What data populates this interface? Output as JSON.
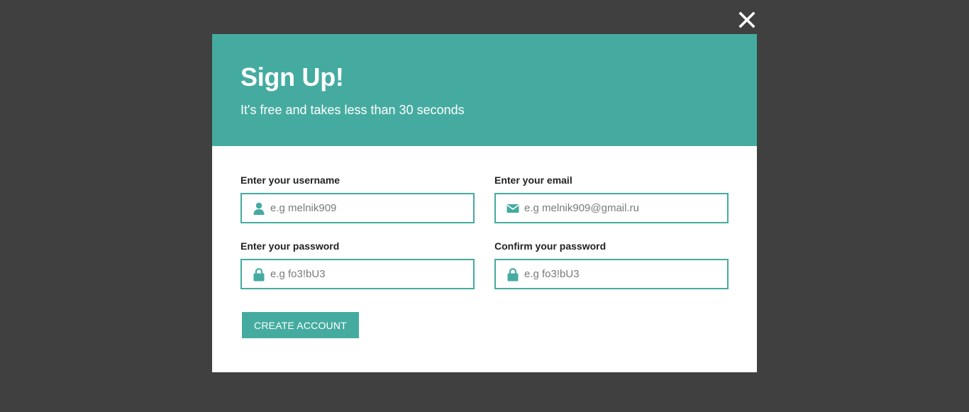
{
  "modal": {
    "title": "Sign Up!",
    "subtitle": "It's free and takes less than 30 seconds",
    "close_icon": "close-icon"
  },
  "form": {
    "username": {
      "label": "Enter your username",
      "placeholder": "e.g melnik909",
      "value": "",
      "icon": "user-icon"
    },
    "email": {
      "label": "Enter your email",
      "placeholder": "e.g melnik909@gmail.ru",
      "value": "",
      "icon": "envelope-icon"
    },
    "password": {
      "label": "Enter your password",
      "placeholder": "e.g fo3!bU3",
      "value": "",
      "icon": "lock-icon"
    },
    "confirm_password": {
      "label": "Confirm your password",
      "placeholder": "e.g fo3!bU3",
      "value": "",
      "icon": "lock-icon"
    },
    "submit_label": "CREATE ACCOUNT"
  },
  "colors": {
    "accent": "#45aba0",
    "backdrop": "#404040",
    "modal_background": "#ffffff",
    "label_text": "#222222"
  }
}
